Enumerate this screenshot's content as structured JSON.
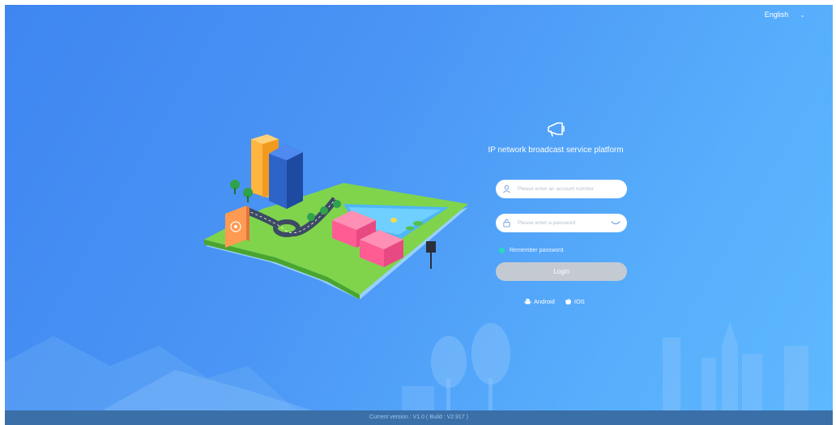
{
  "header": {
    "language": "English",
    "language_chevron": "chevron-down-icon"
  },
  "login": {
    "logo_icon": "megaphone-icon",
    "title": "IP network broadcast service platform",
    "account": {
      "placeholder": "Please enter an account number",
      "value": "",
      "icon": "user-icon"
    },
    "password": {
      "placeholder": "Please enter a password",
      "value": "",
      "icon": "lock-icon",
      "toggle_icon": "eye-closed-icon"
    },
    "remember_label": "Remember password",
    "login_label": "Login",
    "apps": [
      {
        "label": "Android",
        "icon": "android-icon"
      },
      {
        "label": "IOS",
        "icon": "apple-icon"
      }
    ]
  },
  "footer": {
    "version": "Current version : V1.0 ( Build : V2.917 )"
  },
  "colors": {
    "background_start": "#3f86f1",
    "background_end": "#5fb8ff",
    "login_button": "#c4cad2",
    "remember_dot": "#22e3b5",
    "footer": "#3b6fa8"
  }
}
